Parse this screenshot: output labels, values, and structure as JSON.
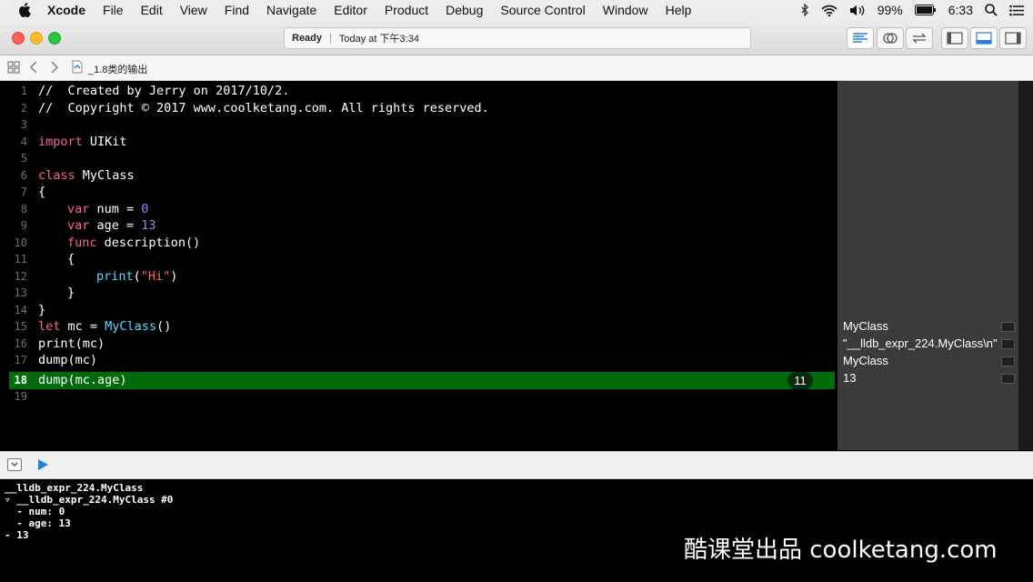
{
  "menubar": {
    "app": "Xcode",
    "items": [
      "File",
      "Edit",
      "View",
      "Find",
      "Navigate",
      "Editor",
      "Product",
      "Debug",
      "Source Control",
      "Window",
      "Help"
    ],
    "battery": "99%",
    "time": "6:33"
  },
  "toolbar": {
    "status_ready": "Ready",
    "status_time": "Today at 下午3:34"
  },
  "jumpbar": {
    "file": "_1.8类的输出"
  },
  "editor": {
    "lines": [
      {
        "n": "1"
      },
      {
        "n": "2"
      },
      {
        "n": "3"
      },
      {
        "n": "4"
      },
      {
        "n": "5"
      },
      {
        "n": "6"
      },
      {
        "n": "7"
      },
      {
        "n": "8"
      },
      {
        "n": "9"
      },
      {
        "n": "10"
      },
      {
        "n": "11"
      },
      {
        "n": "12"
      },
      {
        "n": "13"
      },
      {
        "n": "14"
      },
      {
        "n": "15"
      },
      {
        "n": "16"
      },
      {
        "n": "17"
      },
      {
        "n": "18"
      },
      {
        "n": "19"
      }
    ],
    "code": {
      "l1": "//  Created by Jerry on 2017/10/2.",
      "l2": "//  Copyright © 2017 www.coolketang.com. All rights reserved.",
      "l4_kw": "import",
      "l4_rest": " UIKit",
      "l6_kw": "class",
      "l6_rest": " MyClass",
      "l7": "{",
      "l8_kw": "var",
      "l8_a": " num = ",
      "l8_num": "0",
      "l9_kw": "var",
      "l9_a": " age = ",
      "l9_num": "13",
      "l10_kw": "func",
      "l10_rest": " description()",
      "l11": "{",
      "l12_fn": "print",
      "l12_a": "(",
      "l12_str": "\"Hi\"",
      "l12_b": ")",
      "l13": "}",
      "l14": "}",
      "l15_kw": "let",
      "l15_a": " mc = ",
      "l15_type": "MyClass",
      "l15_b": "()",
      "l16": "print(mc)",
      "l17": "dump(mc)",
      "l18": "dump(mc.age)"
    },
    "exec_count": "11"
  },
  "results": {
    "r15": "MyClass",
    "r16": "\"__lldb_expr_224.MyClass\\n\"",
    "r17": "MyClass",
    "r18": "13"
  },
  "console": {
    "lines": [
      "__lldb_expr_224.MyClass",
      "▿ __lldb_expr_224.MyClass #0",
      "  - num: 0",
      "  - age: 13",
      "- 13"
    ]
  },
  "watermark": "酷课堂出品 coolketang.com",
  "colors": {
    "comment": "#41b645",
    "keyword": "#fc5fa3",
    "number": "#9686f5",
    "string": "#fc6a5d",
    "function": "#5dd8ff",
    "highlight_line": "#006b0a"
  }
}
